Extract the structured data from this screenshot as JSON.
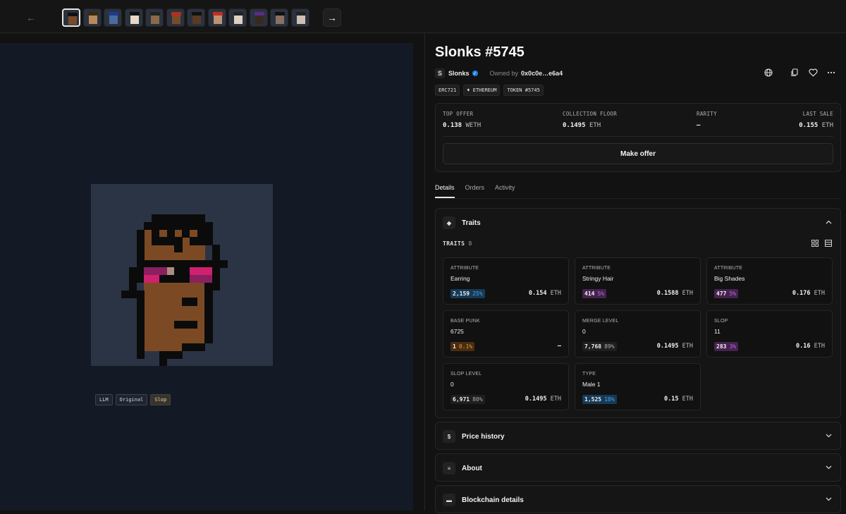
{
  "nav": {
    "prev_icon": "arrow-left-icon",
    "next_icon": "arrow-right-icon",
    "prev_glyph": "←",
    "next_glyph": "→"
  },
  "media": {
    "tags": [
      "LLM",
      "Original",
      "Slop"
    ],
    "active_tag": "Slop"
  },
  "item": {
    "title": "Slonks #5745",
    "collection_logo": "S",
    "collection": "Slonks",
    "owned_label": "Owned by",
    "owner": "0x0c0e…e6a4",
    "chips": [
      "ERC721",
      "♦ ETHEREUM",
      "TOKEN #5745"
    ]
  },
  "stats": {
    "top_offer_label": "TOP OFFER",
    "top_offer_value": "0.138",
    "top_offer_unit": "WETH",
    "floor_label": "COLLECTION FLOOR",
    "floor_value": "0.1495",
    "floor_unit": "ETH",
    "rarity_label": "RARITY",
    "rarity_value": "–",
    "last_sale_label": "LAST SALE",
    "last_sale_value": "0.155",
    "last_sale_unit": "ETH",
    "make_offer": "Make offer"
  },
  "tabs": [
    "Details",
    "Orders",
    "Activity"
  ],
  "traits_panel": {
    "title": "Traits",
    "count_label": "TRAITS",
    "count": "8",
    "traits": [
      {
        "type": "ATTRIBUTE",
        "value": "Earring",
        "count": "2,159",
        "pct": "25%",
        "price": "0.154",
        "unit": "ETH",
        "color": "blue"
      },
      {
        "type": "ATTRIBUTE",
        "value": "Stringy Hair",
        "count": "414",
        "pct": "5%",
        "price": "0.1588",
        "unit": "ETH",
        "color": "purple"
      },
      {
        "type": "ATTRIBUTE",
        "value": "Big Shades",
        "count": "477",
        "pct": "5%",
        "price": "0.176",
        "unit": "ETH",
        "color": "purple"
      },
      {
        "type": "BASE PUNK",
        "value": "6725",
        "count": "1",
        "pct": "0.1%",
        "price": "–",
        "unit": "",
        "color": "orange"
      },
      {
        "type": "MERGE LEVEL",
        "value": "0",
        "count": "7,768",
        "pct": "89%",
        "price": "0.1495",
        "unit": "ETH",
        "color": "gray"
      },
      {
        "type": "SLOP",
        "value": "11",
        "count": "283",
        "pct": "3%",
        "price": "0.16",
        "unit": "ETH",
        "color": "purple"
      },
      {
        "type": "SLOP LEVEL",
        "value": "0",
        "count": "6,971",
        "pct": "80%",
        "price": "0.1495",
        "unit": "ETH",
        "color": "gray"
      },
      {
        "type": "TYPE",
        "value": "Male 1",
        "count": "1,525",
        "pct": "18%",
        "price": "0.15",
        "unit": "ETH",
        "color": "blue"
      }
    ]
  },
  "sections": [
    {
      "title": "Price history",
      "icon": "dollar-icon",
      "glyph": "$"
    },
    {
      "title": "About",
      "icon": "info-icon",
      "glyph": "≡"
    },
    {
      "title": "Blockchain details",
      "icon": "card-icon",
      "glyph": "▬"
    }
  ],
  "colors": {
    "accent_blue": "#2081e2",
    "bg": "#121212",
    "media_bg": "#141a25"
  }
}
